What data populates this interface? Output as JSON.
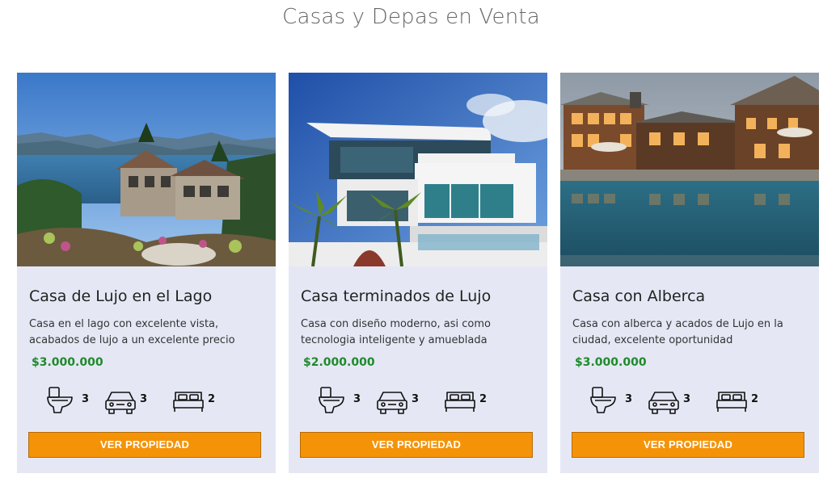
{
  "page": {
    "title": "Casas y Depas en Venta"
  },
  "listings": [
    {
      "title": "Casa de Lujo en el Lago",
      "description": "Casa en el lago con excelente vista, acabados de lujo a un excelente precio",
      "price": "$3.000.000",
      "bathrooms": "3",
      "parking": "3",
      "bedrooms": "2",
      "cta": "VER PROPIEDAD"
    },
    {
      "title": "Casa terminados de Lujo",
      "description": "Casa con diseño moderno, asi como tecnologia inteligente y amueblada",
      "price": "$2.000.000",
      "bathrooms": "3",
      "parking": "3",
      "bedrooms": "2",
      "cta": "VER PROPIEDAD"
    },
    {
      "title": "Casa con Alberca",
      "description": "Casa con alberca y acados de Lujo en la ciudad, excelente oportunidad",
      "price": "$3.000.000",
      "bathrooms": "3",
      "parking": "3",
      "bedrooms": "2",
      "cta": "VER PROPIEDAD"
    }
  ],
  "icons": [
    "toilet-icon",
    "car-icon",
    "bed-icon"
  ],
  "colors": {
    "card_bg": "#e5e8f4",
    "price": "#1f8a2c",
    "button": "#f59308"
  }
}
